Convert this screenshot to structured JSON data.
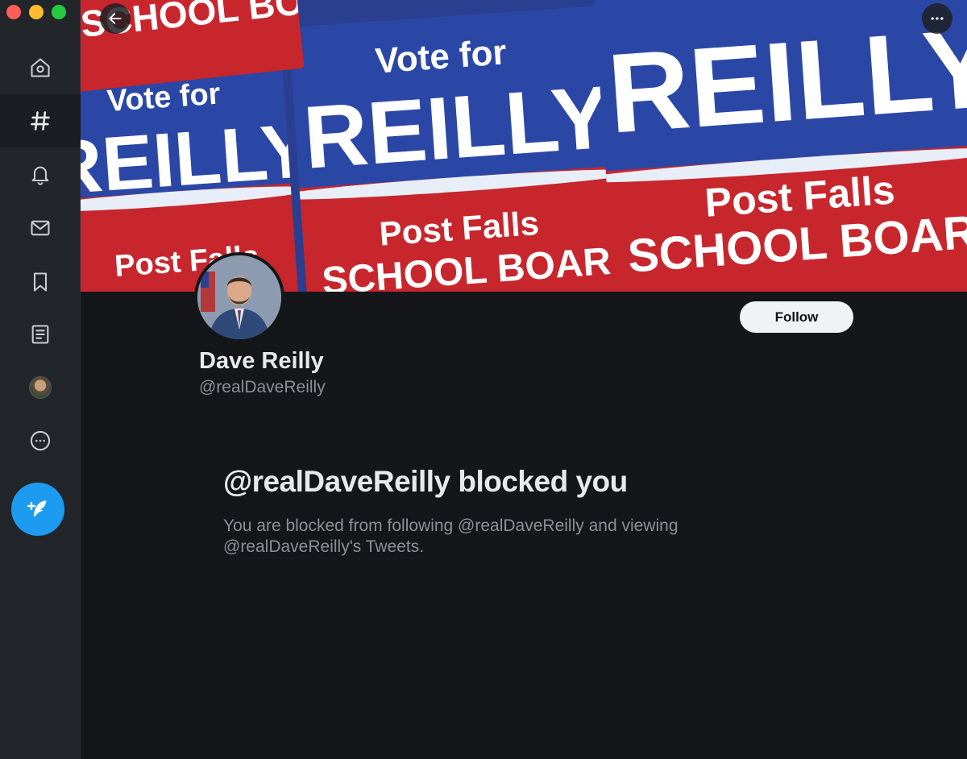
{
  "window": {
    "controls": [
      "close",
      "minimize",
      "maximize"
    ]
  },
  "sidebar": {
    "items": [
      {
        "name": "home",
        "icon": "home-icon",
        "active": false
      },
      {
        "name": "explore",
        "icon": "hashtag-icon",
        "active": true
      },
      {
        "name": "notifications",
        "icon": "bell-icon",
        "active": false
      },
      {
        "name": "messages",
        "icon": "mail-icon",
        "active": false
      },
      {
        "name": "bookmarks",
        "icon": "bookmark-icon",
        "active": false
      },
      {
        "name": "lists",
        "icon": "list-icon",
        "active": false
      },
      {
        "name": "profile",
        "icon": "avatar",
        "active": false
      },
      {
        "name": "more",
        "icon": "more-circle-icon",
        "active": false
      }
    ],
    "compose_icon": "feather-plus-icon"
  },
  "banner": {
    "signs": [
      {
        "top_line": "Vote for",
        "name": "REILLY",
        "bottom_line1": "Post Falls",
        "bottom_line2": "SCHOOL BOARD"
      }
    ],
    "back_icon": "arrow-left-icon",
    "more_icon": "more-horizontal-icon"
  },
  "profile": {
    "display_name": "Dave Reilly",
    "handle": "@realDaveReilly",
    "follow_label": "Follow"
  },
  "blocked": {
    "title": "@realDaveReilly blocked you",
    "description": "You are blocked from following @realDaveReilly and viewing @realDaveReilly's Tweets."
  },
  "colors": {
    "background": "#15161a",
    "sidebar": "#22262a",
    "accent": "#1d9bf0",
    "primary_text": "#e7e9ea",
    "secondary_text": "#8b9096",
    "sign_blue": "#2b47a6",
    "sign_red": "#c8262d"
  }
}
